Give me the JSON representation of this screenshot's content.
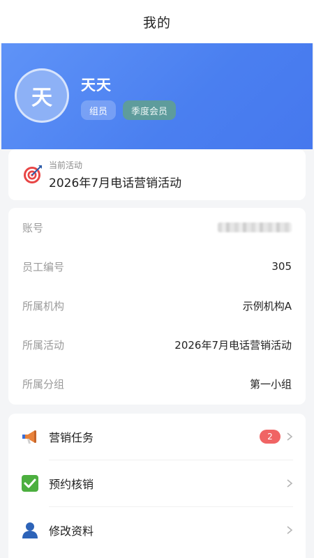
{
  "nav": {
    "title": "我的"
  },
  "profile": {
    "avatar_char": "天",
    "name": "天天",
    "role_tag": "组员",
    "membership_tag": "季度会员"
  },
  "activity": {
    "caption": "当前活动",
    "value": "2026年7月电话营销活动",
    "icon": "target-icon"
  },
  "info": {
    "rows": [
      {
        "label": "账号",
        "value": ""
      },
      {
        "label": "员工编号",
        "value": "305"
      },
      {
        "label": "所属机构",
        "value": "示例机构A"
      },
      {
        "label": "所属活动",
        "value": "2026年7月电话营销活动"
      },
      {
        "label": "所属分组",
        "value": "第一小组"
      }
    ]
  },
  "menu": {
    "items": [
      {
        "label": "营销任务",
        "icon": "megaphone-icon",
        "badge": "2"
      },
      {
        "label": "预约核销",
        "icon": "checkmark-icon",
        "badge": ""
      },
      {
        "label": "修改资料",
        "icon": "user-icon",
        "badge": ""
      }
    ]
  },
  "colors": {
    "header_blue": "#4a7ff0",
    "badge_red": "#f06464",
    "vip_tag": "#5e9c9c"
  }
}
